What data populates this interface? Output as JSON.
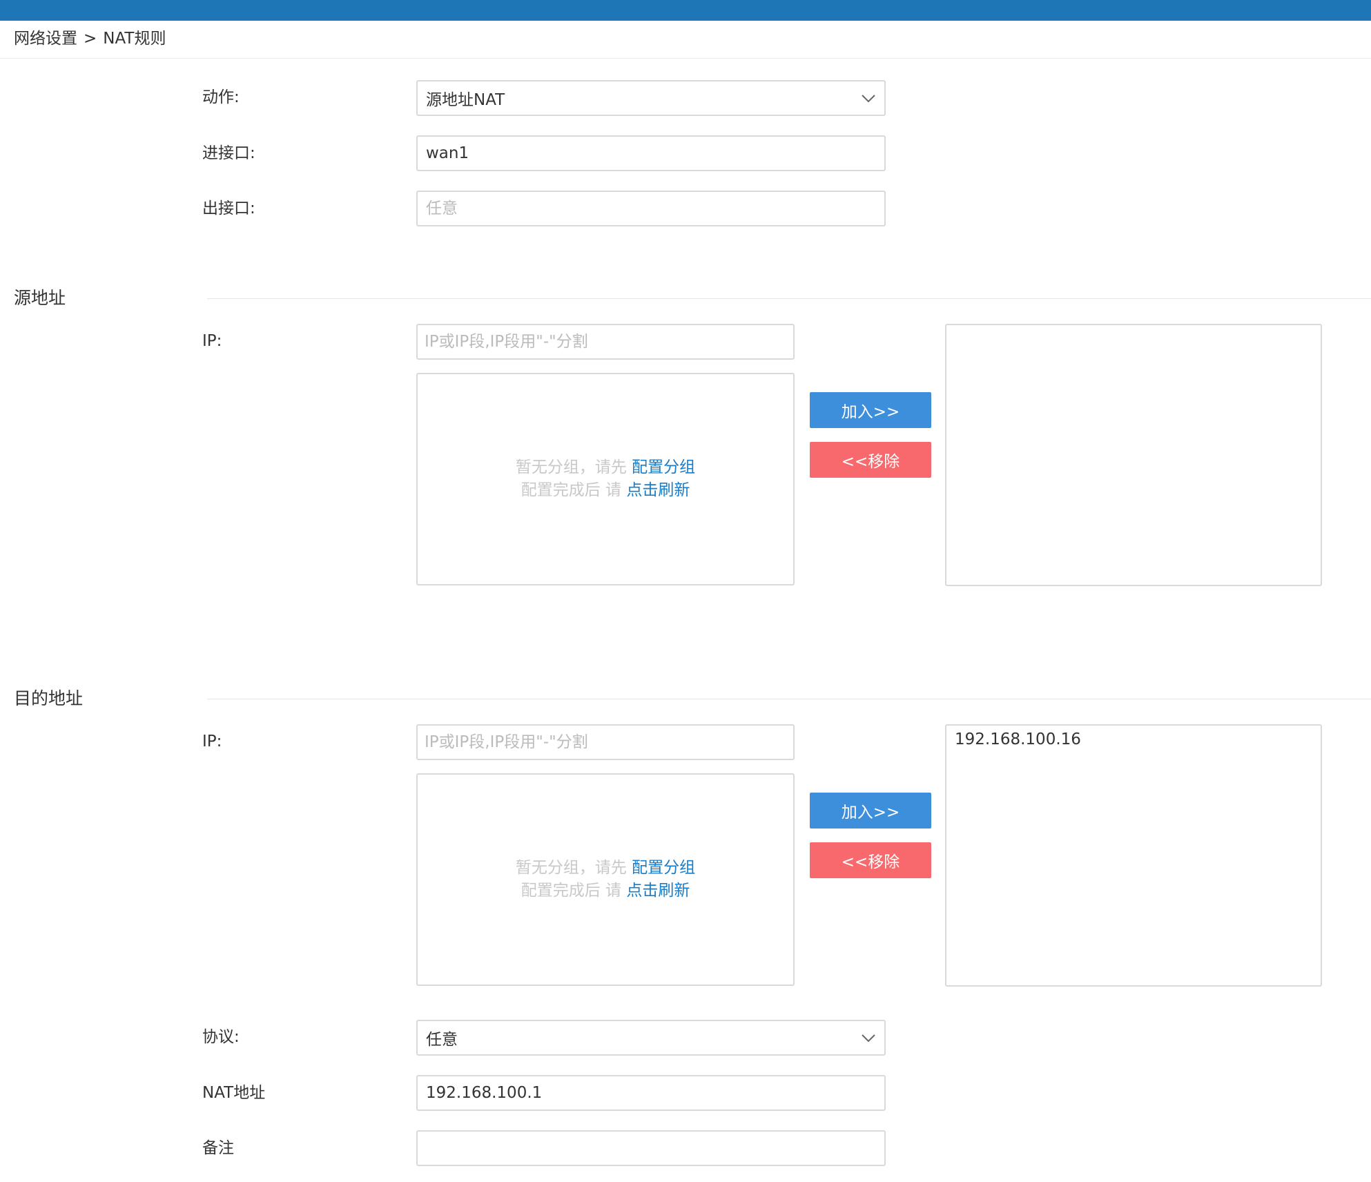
{
  "breadcrumb": {
    "parent": "网络设置",
    "separator": ">",
    "current": "NAT规则"
  },
  "form": {
    "action": {
      "label": "动作:",
      "value": "源地址NAT"
    },
    "in_iface": {
      "label": "进接口:",
      "value": "wan1"
    },
    "out_iface": {
      "label": "出接口:",
      "placeholder": "任意"
    }
  },
  "source": {
    "title": "源地址",
    "ip_label": "IP:",
    "ip_placeholder": "IP或IP段,IP段用\"-\"分割",
    "empty_text_1": "暂无分组，请先",
    "config_link": "配置分组",
    "empty_text_2": "配置完成后 请",
    "refresh_link": "点击刷新",
    "add_label": "加入>>",
    "remove_label": "<<移除",
    "selected": []
  },
  "destination": {
    "title": "目的地址",
    "ip_label": "IP:",
    "ip_placeholder": "IP或IP段,IP段用\"-\"分割",
    "empty_text_1": "暂无分组，请先",
    "config_link": "配置分组",
    "empty_text_2": "配置完成后 请",
    "refresh_link": "点击刷新",
    "add_label": "加入>>",
    "remove_label": "<<移除",
    "selected": [
      "192.168.100.16"
    ]
  },
  "protocol": {
    "label": "协议:",
    "value": "任意"
  },
  "nat_address": {
    "label": "NAT地址",
    "value": "192.168.100.1"
  },
  "remark": {
    "label": "备注",
    "value": ""
  },
  "colors": {
    "top_bar": "#1f76b7",
    "add_button": "#3d8fdb",
    "remove_button": "#f7696c",
    "link": "#1a7cc7"
  },
  "icons": {
    "select_arrow": "chevron-down-icon"
  }
}
